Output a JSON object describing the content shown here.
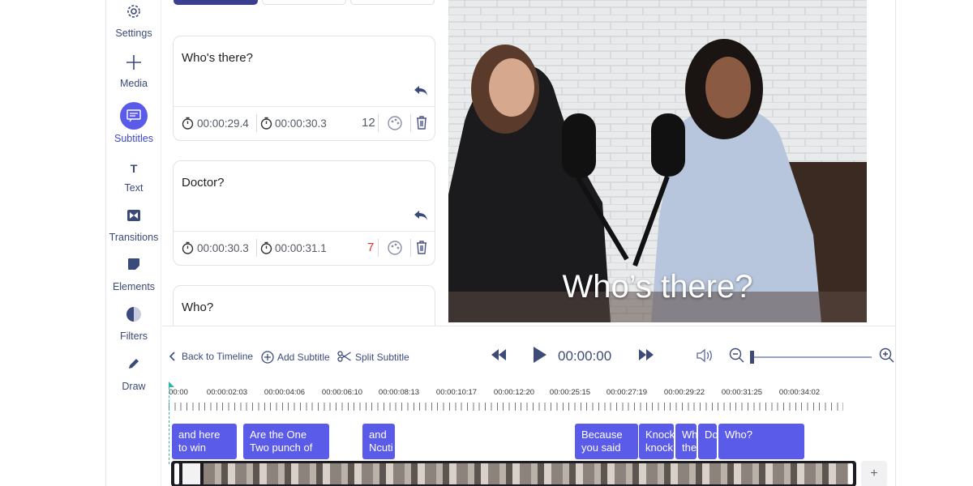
{
  "sidebar": {
    "items": [
      {
        "label": "Settings"
      },
      {
        "label": "Media"
      },
      {
        "label": "Subtitles"
      },
      {
        "label": "Text"
      },
      {
        "label": "Transitions"
      },
      {
        "label": "Elements"
      },
      {
        "label": "Filters"
      },
      {
        "label": "Draw"
      }
    ]
  },
  "subtitles": [
    {
      "text": "Who's there?",
      "start": "00:00:29.4",
      "end": "00:00:30.3",
      "chars": "12",
      "chars_color": "#555a66"
    },
    {
      "text": "Doctor?",
      "start": "00:00:30.3",
      "end": "00:00:31.1",
      "chars": "7",
      "chars_color": "#e0302f"
    },
    {
      "text": "Who?"
    }
  ],
  "video": {
    "caption": "Who’s there?"
  },
  "toolbar": {
    "back_label": "Back to Timeline",
    "add_label": "Add Subtitle",
    "split_label": "Split Subtitle",
    "time": "00:00:00"
  },
  "ruler": [
    "00:00",
    "00:00:02:03",
    "00:00:04:06",
    "00:00:06:10",
    "00:00:08:13",
    "00:00:10:17",
    "00:00:12:20",
    "00:00:25:15",
    "00:00:27:19",
    "00:00:29:22",
    "00:00:31:25",
    "00:00:34:02"
  ],
  "clips": [
    {
      "text": "and here\nto win"
    },
    {
      "text": "Are the One\nTwo punch of"
    },
    {
      "text": "and\nNcuti"
    },
    {
      "text": "Because\nyou said"
    },
    {
      "text": "Knock\nknock"
    },
    {
      "text": "Wh\nthe"
    },
    {
      "text": "Do"
    },
    {
      "text": "Who?"
    }
  ],
  "colors": {
    "accent": "#5b5bea",
    "text_primary": "#3b4a7c",
    "warning": "#e0302f"
  }
}
